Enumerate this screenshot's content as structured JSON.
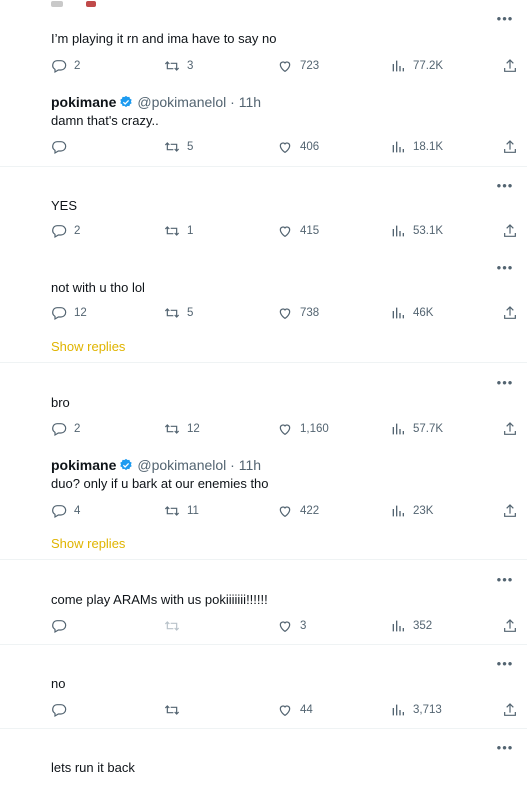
{
  "tweets": [
    {
      "text": "I’m playing it rn and ima have to say no",
      "reply": "2",
      "retweet": "3",
      "like": "723",
      "views": "77.2K"
    },
    {
      "name": "pokimane",
      "handle": "@pokimanelol · 11h",
      "text": "damn that's crazy..",
      "reply": "",
      "retweet": "5",
      "like": "406",
      "views": "18.1K"
    },
    {
      "text": "YES",
      "reply": "2",
      "retweet": "1",
      "like": "415",
      "views": "53.1K"
    },
    {
      "text": "not with u tho lol",
      "reply": "12",
      "retweet": "5",
      "like": "738",
      "views": "46K",
      "show_replies": "Show replies"
    },
    {
      "text": "bro",
      "reply": "2",
      "retweet": "12",
      "like": "1,160",
      "views": "57.7K"
    },
    {
      "name": "pokimane",
      "handle": "@pokimanelol · 11h",
      "text": "duo? only if u bark at our enemies tho",
      "reply": "4",
      "retweet": "11",
      "like": "422",
      "views": "23K",
      "show_replies": "Show replies"
    },
    {
      "text": "come play ARAMs with us pokiiiiiii!!!!!!",
      "reply": "",
      "retweet": "",
      "like": "3",
      "views": "352"
    },
    {
      "text": "no",
      "reply": "",
      "retweet": "",
      "like": "44",
      "views": "3,713"
    },
    {
      "text": "lets run it back"
    }
  ],
  "more_label": "•••",
  "colors": {
    "accent": "#e0b400",
    "verified": "#1d9bf0",
    "muted": "#536471"
  }
}
